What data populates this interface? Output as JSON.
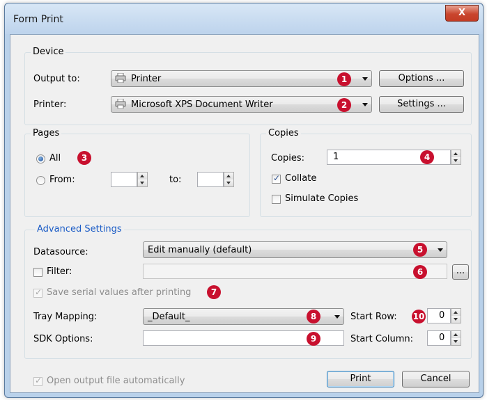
{
  "window": {
    "title": "Form Print",
    "close_glyph": "X"
  },
  "device": {
    "legend": "Device",
    "output_label": "Output to:",
    "output_value": "Printer",
    "output_icon": "printer-icon",
    "options_button": "Options ...",
    "printer_label": "Printer:",
    "printer_value": "Microsoft XPS Document Writer",
    "printer_icon": "printer-icon",
    "settings_button": "Settings ..."
  },
  "pages": {
    "legend": "Pages",
    "all_label": "All",
    "from_label": "From:",
    "to_label": "to:",
    "from_value": "",
    "to_value": ""
  },
  "copies": {
    "legend": "Copies",
    "copies_label": "Copies:",
    "copies_value": "1",
    "collate_label": "Collate",
    "collate_checked": true,
    "simulate_label": "Simulate Copies",
    "simulate_checked": false
  },
  "advanced": {
    "header": "Advanced Settings",
    "datasource_label": "Datasource:",
    "datasource_value": "Edit manually (default)",
    "filter_label": "Filter:",
    "filter_value": "",
    "browse_button": "...",
    "save_serial_label": "Save serial values after printing",
    "tray_mapping_label": "Tray Mapping:",
    "tray_mapping_value": "_Default_",
    "start_row_label": "Start Row:",
    "start_row_value": "0",
    "sdk_options_label": "SDK Options:",
    "sdk_options_value": "",
    "start_column_label": "Start Column:",
    "start_column_value": "0"
  },
  "footer": {
    "open_output_label": "Open output file automatically",
    "print_button": "Print",
    "cancel_button": "Cancel"
  },
  "markers": {
    "m1": "1",
    "m2": "2",
    "m3": "3",
    "m4": "4",
    "m5": "5",
    "m6": "6",
    "m7": "7",
    "m8": "8",
    "m9": "9",
    "m10": "10"
  },
  "colors": {
    "marker": "#c8102e",
    "link": "#1b5cc6",
    "frame": "#b9d1ea"
  }
}
